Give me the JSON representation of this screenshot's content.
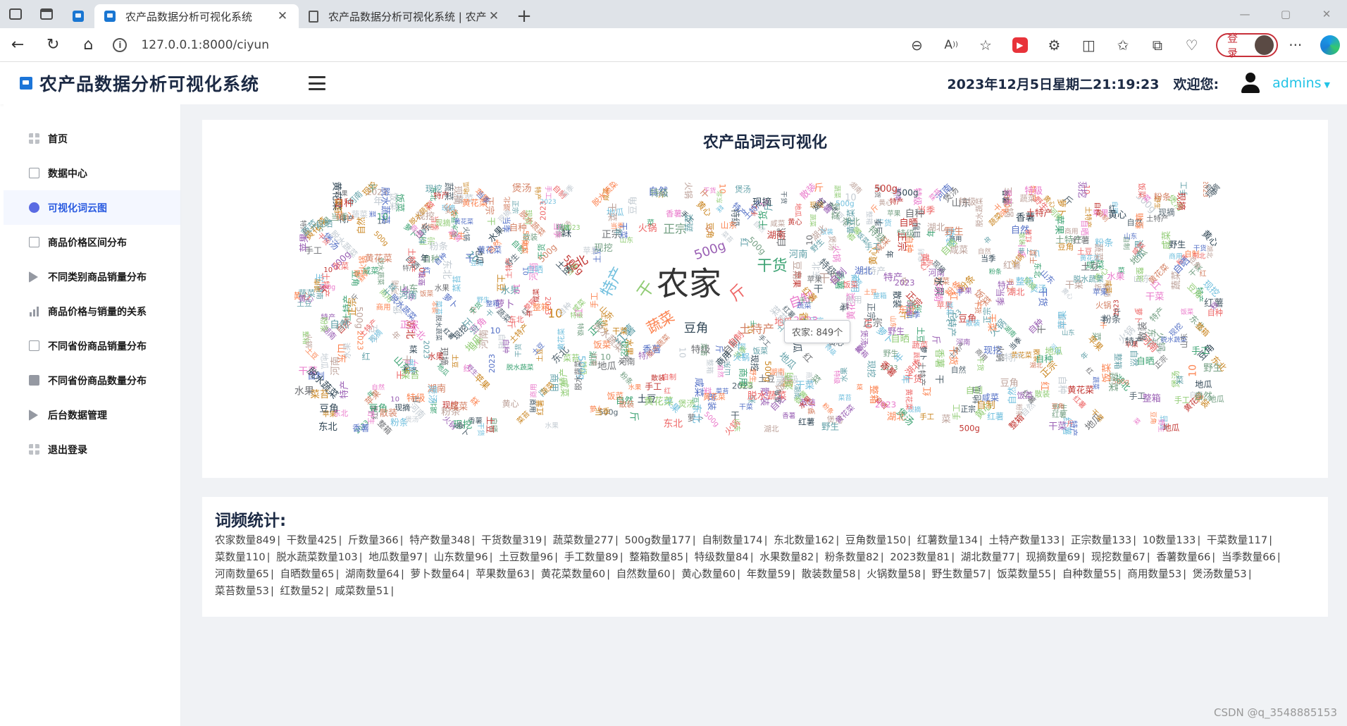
{
  "browser": {
    "tabs": [
      {
        "title": "农产品数据分析可视化系统",
        "active": true
      },
      {
        "title": "农产品数据分析可视化系统 | 农产",
        "active": false
      }
    ],
    "url": "127.0.0.1:8000/ciyun",
    "login_label": "登录"
  },
  "header": {
    "title": "农产品数据分析可视化系统",
    "datetime": "2023年12月5日星期二21:19:23",
    "welcome": "欢迎您:",
    "username": "admins"
  },
  "sidebar": {
    "items": [
      {
        "label": "首页",
        "icon": "grid-icon"
      },
      {
        "label": "数据中心",
        "icon": "document-icon"
      },
      {
        "label": "可视化词云图",
        "icon": "wordpress-icon",
        "active": true
      },
      {
        "label": "商品价格区间分布",
        "icon": "printer-icon"
      },
      {
        "label": "不同类别商品销量分布",
        "icon": "play-icon"
      },
      {
        "label": "商品价格与销量的关系",
        "icon": "bar-chart-icon"
      },
      {
        "label": "不同省份商品销量分布",
        "icon": "columns-icon"
      },
      {
        "label": "不同省份商品数量分布",
        "icon": "barcode-icon"
      },
      {
        "label": "后台数据管理",
        "icon": "play-icon"
      },
      {
        "label": "退出登录",
        "icon": "grid-icon"
      }
    ]
  },
  "cloud": {
    "title": "农产品词云可视化",
    "tooltip": "农家: 849个",
    "palette": [
      "#5470c6",
      "#91cc75",
      "#ee6666",
      "#73c0de",
      "#3ba272",
      "#fc8452",
      "#9a60b4",
      "#ea7ccc",
      "#c23531",
      "#2f4554",
      "#61a0a8",
      "#d48265",
      "#749f83",
      "#ca8622",
      "#bda29a",
      "#6e7074",
      "#546570",
      "#c4ccd3"
    ]
  },
  "freq": {
    "title": "词频统计:",
    "items": [
      "农家数量849",
      "干数量425",
      "斤数量366",
      "特产数量348",
      "干货数量319",
      "蔬菜数量277",
      "500g数量177",
      "自制数量174",
      "东北数量162",
      "豆角数量150",
      "红薯数量134",
      "土特产数量133",
      "正宗数量133",
      "10数量133",
      "干菜数量117",
      "菜数量110",
      "脱水蔬菜数量103",
      "地瓜数量97",
      "山东数量96",
      "土豆数量96",
      "手工数量89",
      "整箱数量85",
      "特级数量84",
      "水果数量82",
      "粉条数量82",
      "2023数量81",
      "湖北数量77",
      "现摘数量69",
      "现挖数量67",
      "香薯数量66",
      "当季数量66",
      "河南数量65",
      "自晒数量65",
      "湖南数量64",
      "萝卜数量64",
      "苹果数量63",
      "黄花菜数量60",
      "自然数量60",
      "黄心数量60",
      "年数量59",
      "散装数量58",
      "火锅数量58",
      "野生数量57",
      "饭菜数量55",
      "自种数量55",
      "商用数量53",
      "煲汤数量53",
      "菜苔数量53",
      "红数量52",
      "咸菜数量51"
    ]
  },
  "watermark": "CSDN @q_3548885153"
}
